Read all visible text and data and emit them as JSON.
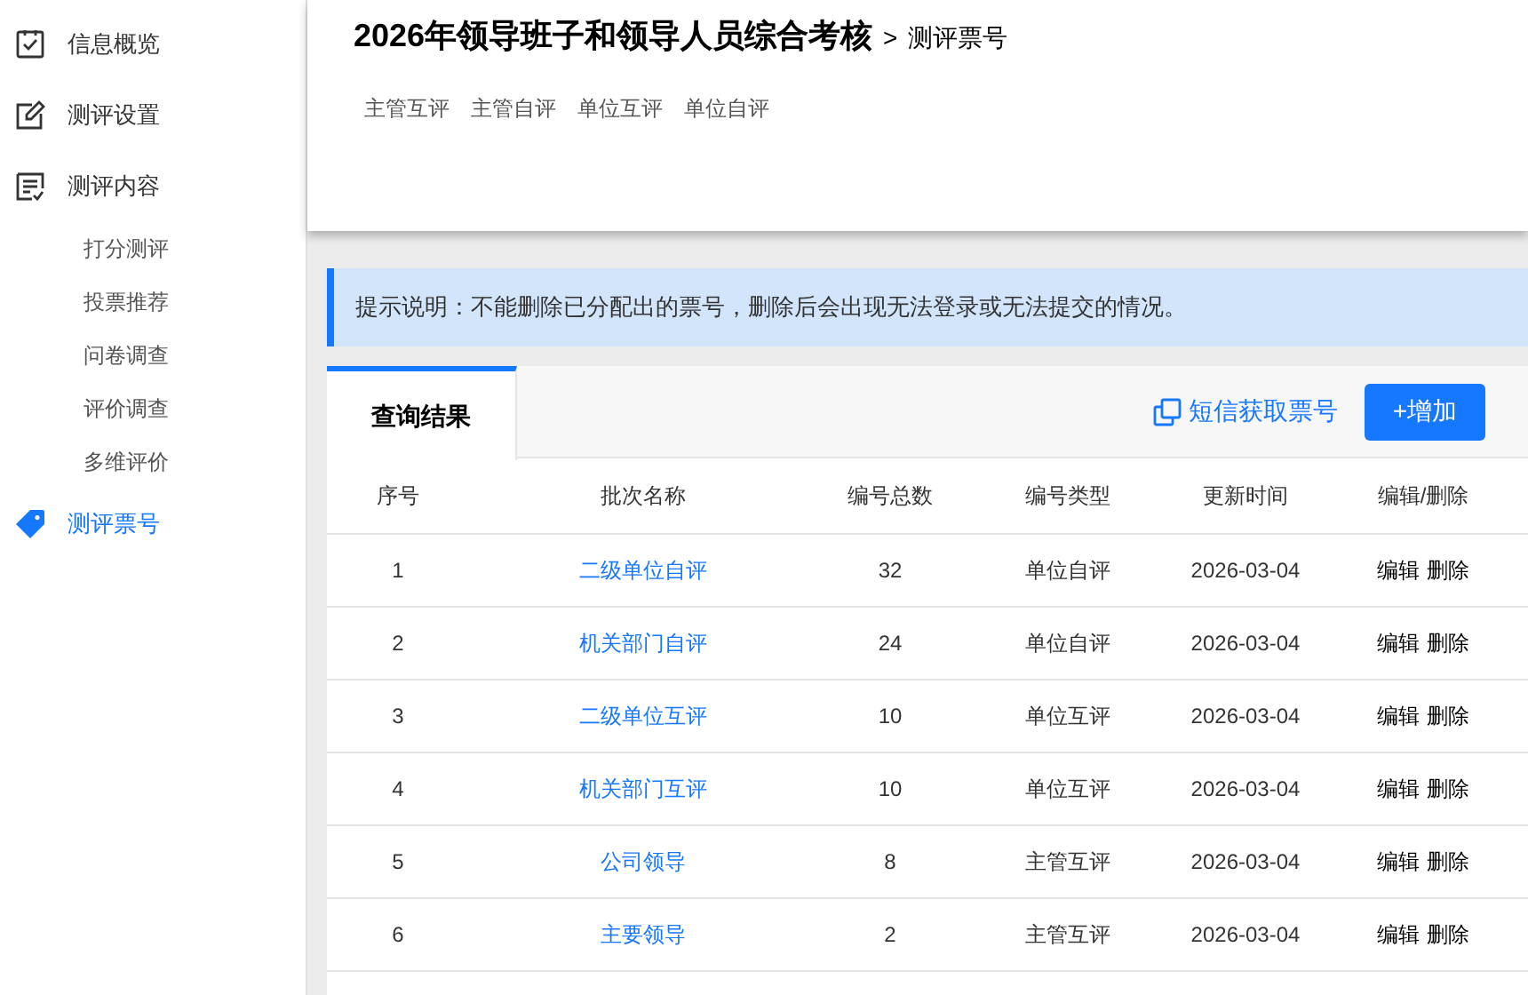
{
  "sidebar": {
    "items": [
      {
        "label": "信息概览",
        "selected": false
      },
      {
        "label": "测评设置",
        "selected": false
      },
      {
        "label": "测评内容",
        "selected": false,
        "children": [
          {
            "label": "打分测评",
            "selected": false
          },
          {
            "label": "投票推荐",
            "selected": false
          },
          {
            "label": "问卷调查",
            "selected": false
          },
          {
            "label": "评价调查",
            "selected": false
          },
          {
            "label": "多维评价",
            "selected": false
          }
        ]
      },
      {
        "label": "测评票号",
        "selected": true
      }
    ]
  },
  "header": {
    "title": "2026年领导班子和领导人员综合考核",
    "separator": ">",
    "current": "测评票号",
    "links": [
      "主管互评",
      "主管自评",
      "单位互评",
      "单位自评"
    ]
  },
  "notice": "提示说明：不能删除已分配出的票号，删除后会出现无法登录或无法提交的情况。",
  "panel": {
    "tabs": [
      {
        "label": "查询结果",
        "selected": true
      }
    ],
    "sms_link": "短信获取票号",
    "add_button": "+增加"
  },
  "table": {
    "columns": [
      "序号",
      "批次名称",
      "编号总数",
      "编号类型",
      "更新时间",
      "编辑/删除"
    ],
    "rows": [
      {
        "index": "1",
        "name": "二级单位自评",
        "count": "32",
        "type": "单位自评",
        "updated": "2026-03-04",
        "edit": "编辑",
        "delete": "删除"
      },
      {
        "index": "2",
        "name": "机关部门自评",
        "count": "24",
        "type": "单位自评",
        "updated": "2026-03-04",
        "edit": "编辑",
        "delete": "删除"
      },
      {
        "index": "3",
        "name": "二级单位互评",
        "count": "10",
        "type": "单位互评",
        "updated": "2026-03-04",
        "edit": "编辑",
        "delete": "删除"
      },
      {
        "index": "4",
        "name": "机关部门互评",
        "count": "10",
        "type": "单位互评",
        "updated": "2026-03-04",
        "edit": "编辑",
        "delete": "删除"
      },
      {
        "index": "5",
        "name": "公司领导",
        "count": "8",
        "type": "主管互评",
        "updated": "2026-03-04",
        "edit": "编辑",
        "delete": "删除"
      },
      {
        "index": "6",
        "name": "主要领导",
        "count": "2",
        "type": "主管互评",
        "updated": "2026-03-04",
        "edit": "编辑",
        "delete": "删除"
      }
    ]
  }
}
